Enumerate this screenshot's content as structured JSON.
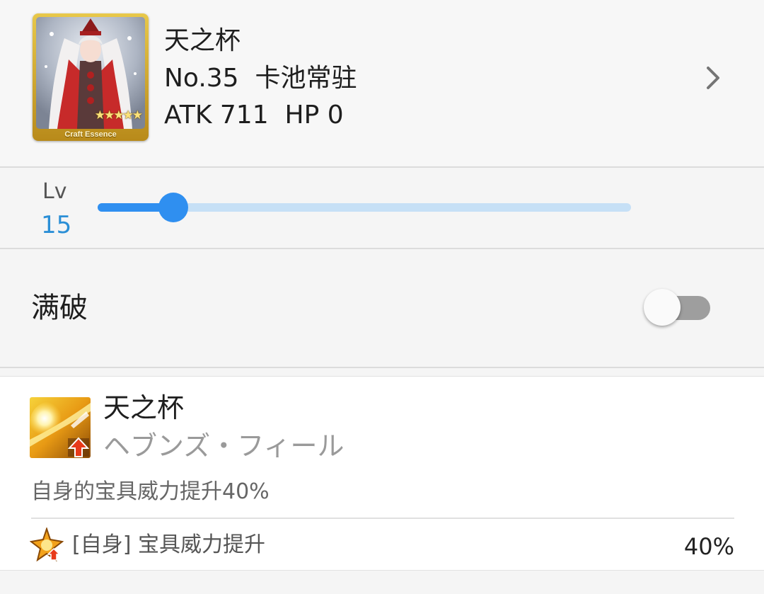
{
  "craft_essence": {
    "name": "天之杯",
    "number_text": "No.35",
    "obtain_text": "卡池常驻",
    "atk_label": "ATK",
    "atk_value": "711",
    "hp_label": "HP",
    "hp_value": "0",
    "thumbnail_caption": "Craft Essence",
    "rarity_stars": 5,
    "chevron_icon": "chevron-right-icon"
  },
  "level": {
    "label": "Lv",
    "value": "15",
    "current": 15,
    "min": 1,
    "max": 100,
    "accent_color": "#2f8ff0",
    "track_color": "#c6e0f6",
    "value_color": "#2b8fd6"
  },
  "limit_break": {
    "label": "满破",
    "enabled": false
  },
  "skill": {
    "name": "天之杯",
    "ruby": "ヘブンズ・フィール",
    "description": "自身的宝具威力提升40%",
    "icon": "np-damage-up-icon",
    "effects": [
      {
        "icon": "buff-star-icon",
        "text": "[自身] 宝具威力提升",
        "value": "40%"
      }
    ]
  }
}
